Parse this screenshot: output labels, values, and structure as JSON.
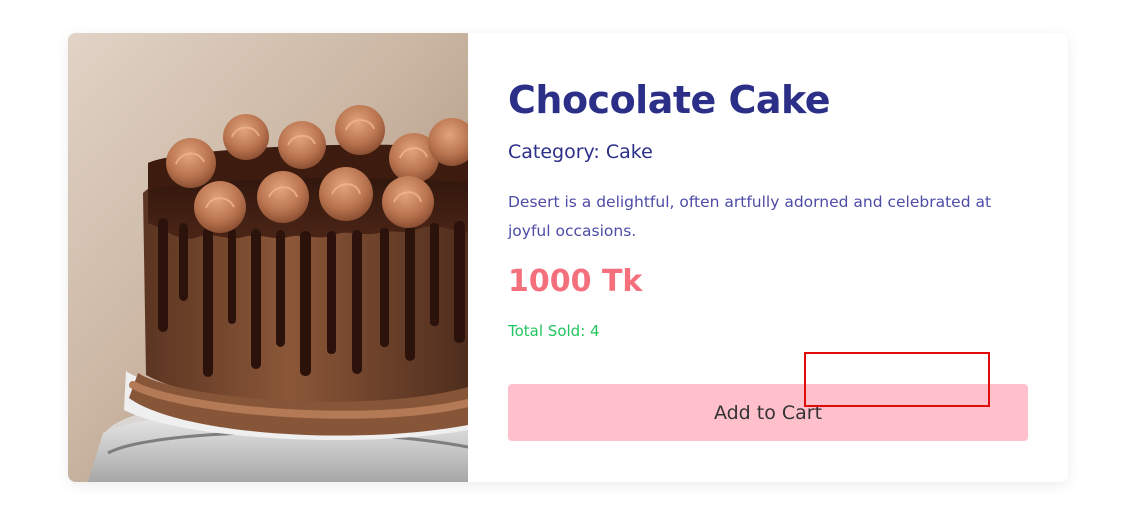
{
  "product": {
    "title": "Chocolate Cake",
    "category_label": "Category: Cake",
    "description": "Desert is a delightful, often artfully adorned and celebrated at joyful occasions.",
    "price": "1000 Tk",
    "total_sold": "Total Sold: 4"
  },
  "actions": {
    "add_to_cart_label": "Add to Cart"
  },
  "colors": {
    "title": "#2c2f88",
    "price": "#f4707d",
    "sold": "#22c55e",
    "button": "#ffc0cc",
    "focus_box": "#e10b0b"
  }
}
